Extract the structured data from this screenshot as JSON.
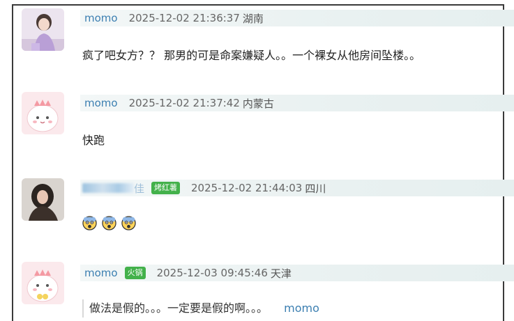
{
  "comments": [
    {
      "user": "momo",
      "time": "2025-12-02 21:36:37",
      "location": "湖南",
      "text": "疯了吧女方？？ 那男的可是命案嫌疑人。。一个裸女从他房间坠楼。。"
    },
    {
      "user": "momo",
      "time": "2025-12-02 21:37:42",
      "location": "内蒙古",
      "text": "快跑"
    },
    {
      "user_suffix": "佳",
      "badge": "烤红薯",
      "time": "2025-12-02 21:44:03",
      "location": "四川",
      "emoji_name": "fearful-face"
    },
    {
      "user": "momo",
      "badge": "火锅",
      "time": "2025-12-03 09:45:46",
      "location": "天津",
      "quote_text": "做法是假的。。。一定要是假的啊。。。",
      "quote_user": "momo"
    }
  ],
  "colors": {
    "username": "#3c7fb1",
    "badge": "#43b14b",
    "header_bg": "#eaf2f2"
  }
}
